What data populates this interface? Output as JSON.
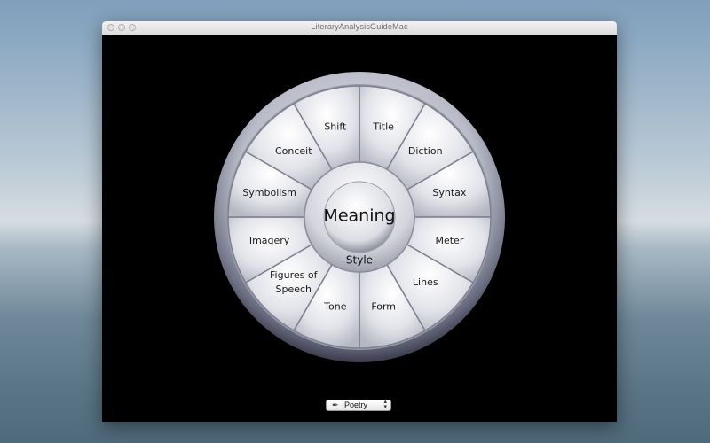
{
  "window": {
    "title": "LiteraryAnalysisGuideMac"
  },
  "wheel": {
    "center_label": "Meaning",
    "inner_ring_label": "Style",
    "segments": [
      {
        "label": "Title"
      },
      {
        "label": "Diction"
      },
      {
        "label": "Syntax"
      },
      {
        "label": "Meter"
      },
      {
        "label": "Lines"
      },
      {
        "label": "Form"
      },
      {
        "label": "Tone"
      },
      {
        "label": "Figures of Speech"
      },
      {
        "label": "Imagery"
      },
      {
        "label": "Symbolism"
      },
      {
        "label": "Conceit"
      },
      {
        "label": "Shift"
      }
    ]
  },
  "popup": {
    "selected": "Poetry",
    "icon": "quill-icon"
  }
}
